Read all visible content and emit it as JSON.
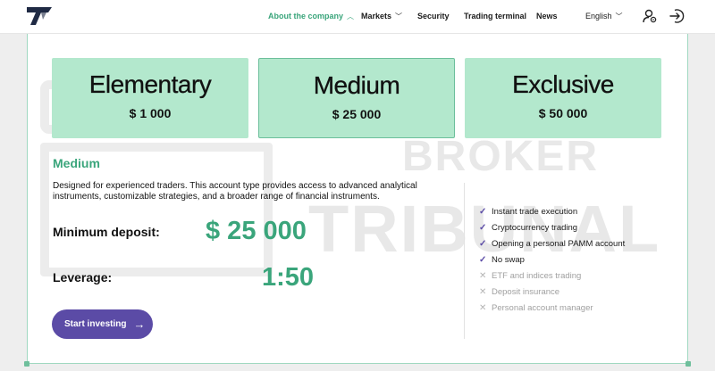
{
  "header": {
    "nav": [
      {
        "label": "About the company",
        "chevron": "up",
        "active": true
      },
      {
        "label": "Markets",
        "chevron": "down",
        "active": false
      },
      {
        "label": "Security",
        "chevron": "",
        "active": false
      },
      {
        "label": "Trading terminal",
        "chevron": "",
        "active": false
      },
      {
        "label": "News",
        "chevron": "",
        "active": false
      }
    ],
    "language": "English",
    "language_chevron": "down",
    "icons": [
      "logo-icon",
      "user-settings-icon",
      "login-icon"
    ]
  },
  "watermark": {
    "line1": "BROKER",
    "line2": "TRIBUNAL"
  },
  "plans": [
    {
      "name": "Elementary",
      "price": "$ 1 000",
      "selected": false
    },
    {
      "name": "Medium",
      "price": "$ 25 000",
      "selected": true
    },
    {
      "name": "Exclusive",
      "price": "$ 50 000",
      "selected": false
    }
  ],
  "detail": {
    "title": "Medium",
    "description": "Designed for experienced traders. This account type provides access to advanced analytical instruments, customizable strategies, and a broader range of financial instruments.",
    "min_deposit_label": "Minimum deposit:",
    "min_deposit_value": "$ 25 000",
    "leverage_label": "Leverage:",
    "leverage_value": "1:50",
    "cta": "Start investing"
  },
  "features": [
    {
      "label": "Instant trade execution",
      "included": true
    },
    {
      "label": "Cryptocurrency trading",
      "included": true
    },
    {
      "label": "Opening a personal PAMM account",
      "included": true
    },
    {
      "label": "No swap",
      "included": true
    },
    {
      "label": "ETF and indices trading",
      "included": false
    },
    {
      "label": "Deposit insurance",
      "included": false
    },
    {
      "label": "Personal account manager",
      "included": false
    }
  ],
  "colors": {
    "accent": "#3aa57b",
    "tile": "#b3e8cd",
    "button": "#5b4ba6"
  }
}
